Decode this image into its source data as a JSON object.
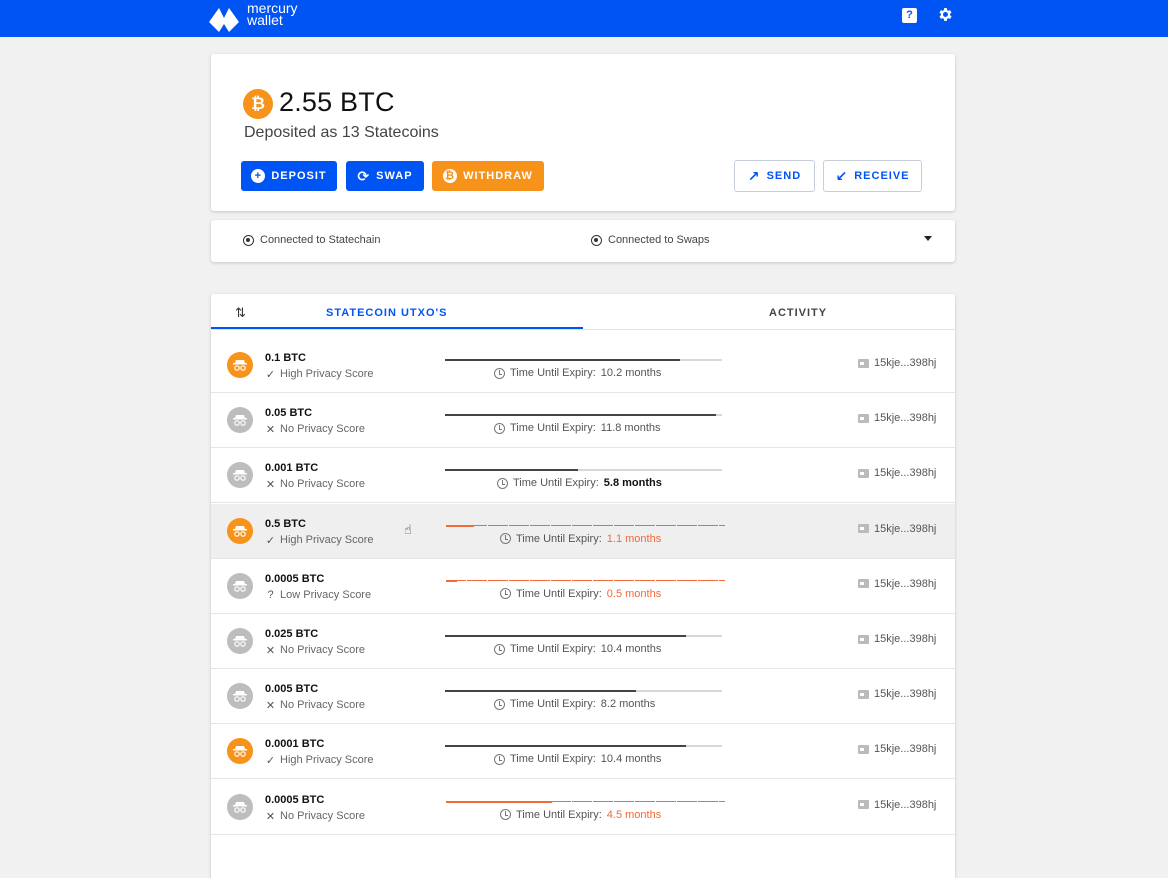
{
  "app": {
    "logo_line1": "mercury",
    "logo_line2": "wallet",
    "help_icon": "?",
    "accent": "#0054f4",
    "bitcoin_color": "#f7931a",
    "warning_color": "#f06a3a"
  },
  "balance": {
    "amount": "2.55 BTC",
    "subtitle": "Deposited as 13 Statecoins",
    "btc_symbol": "₿"
  },
  "actions": {
    "deposit": "DEPOSIT",
    "swap": "SWAP",
    "withdraw": "WITHDRAW",
    "send": "SEND",
    "receive": "RECEIVE"
  },
  "status": {
    "statechain": "Connected to Statechain",
    "swaps": "Connected to Swaps"
  },
  "tabs": {
    "utxo": "STATECOIN UTXO'S",
    "activity": "ACTIVITY"
  },
  "rows": [
    {
      "amount": "0.1 BTC",
      "privacy_mark": "✓",
      "privacy": "High Privacy Score",
      "coin": "orange",
      "expiry_label": "Time Until Expiry:",
      "expiry_value": "10.2 months",
      "expiry_style": "normal",
      "progress": 0.85,
      "address": "15kje...398hj"
    },
    {
      "amount": "0.05 BTC",
      "privacy_mark": "✕",
      "privacy": "No Privacy Score",
      "coin": "grey",
      "expiry_label": "Time Until Expiry:",
      "expiry_value": "11.8 months",
      "expiry_style": "normal",
      "progress": 0.98,
      "address": "15kje...398hj"
    },
    {
      "amount": "0.001 BTC",
      "privacy_mark": "✕",
      "privacy": "No Privacy Score",
      "coin": "grey",
      "expiry_label": "Time Until Expiry:",
      "expiry_value": "5.8 months",
      "expiry_style": "bold",
      "progress": 0.48,
      "address": "15kje...398hj"
    },
    {
      "amount": "0.5 BTC",
      "privacy_mark": "✓",
      "privacy": "High Privacy Score",
      "coin": "orange",
      "expiry_label": "Time Until Expiry:",
      "expiry_value": "1.1 months",
      "expiry_style": "warn",
      "progress": 0.1,
      "address": "15kje...398hj"
    },
    {
      "amount": "0.0005 BTC",
      "privacy_mark": "?",
      "privacy": "Low Privacy Score",
      "coin": "grey",
      "expiry_label": "Time Until Expiry:",
      "expiry_value": "0.5 months",
      "expiry_style": "warn",
      "progress": 0.04,
      "address": "15kje...398hj"
    },
    {
      "amount": "0.025 BTC",
      "privacy_mark": "✕",
      "privacy": "No Privacy Score",
      "coin": "grey",
      "expiry_label": "Time Until Expiry:",
      "expiry_value": "10.4 months",
      "expiry_style": "normal",
      "progress": 0.87,
      "address": "15kje...398hj"
    },
    {
      "amount": "0.005 BTC",
      "privacy_mark": "✕",
      "privacy": "No Privacy Score",
      "coin": "grey",
      "expiry_label": "Time Until Expiry:",
      "expiry_value": "8.2 months",
      "expiry_style": "normal",
      "progress": 0.69,
      "address": "15kje...398hj"
    },
    {
      "amount": "0.0001 BTC",
      "privacy_mark": "✓",
      "privacy": "High Privacy Score",
      "coin": "orange",
      "expiry_label": "Time Until Expiry:",
      "expiry_value": "10.4 months",
      "expiry_style": "normal",
      "progress": 0.87,
      "address": "15kje...398hj"
    },
    {
      "amount": "0.0005 BTC",
      "privacy_mark": "✕",
      "privacy": "No Privacy Score",
      "coin": "grey",
      "expiry_label": "Time Until Expiry:",
      "expiry_value": "4.5 months",
      "expiry_style": "warn",
      "progress": 0.38,
      "address": "15kje...398hj"
    }
  ]
}
